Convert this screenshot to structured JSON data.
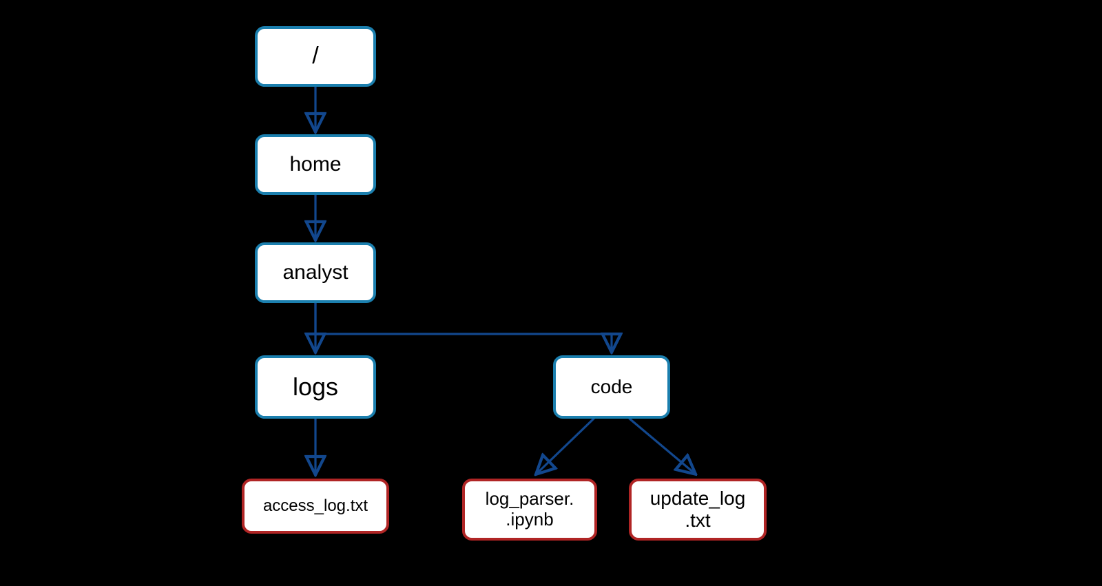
{
  "colors": {
    "background": "#000000",
    "directory_border": "#1b7fae",
    "file_border": "#b02525",
    "edge_stroke": "#12478d",
    "node_fill": "#ffffff"
  },
  "nodes": {
    "root": {
      "label": "/",
      "type": "directory"
    },
    "home": {
      "label": "home",
      "type": "directory"
    },
    "analyst": {
      "label": "analyst",
      "type": "directory"
    },
    "logs": {
      "label": "logs",
      "type": "directory"
    },
    "code": {
      "label": "code",
      "type": "directory"
    },
    "access": {
      "label": "access_log.txt",
      "type": "file"
    },
    "parser": {
      "label": "log_parser.\n.ipynb",
      "type": "file"
    },
    "update": {
      "label": "update_log\n.txt",
      "type": "file"
    }
  },
  "edges": [
    {
      "from": "root",
      "to": "home"
    },
    {
      "from": "home",
      "to": "analyst"
    },
    {
      "from": "analyst",
      "to": "logs"
    },
    {
      "from": "analyst",
      "to": "code"
    },
    {
      "from": "logs",
      "to": "access"
    },
    {
      "from": "code",
      "to": "parser"
    },
    {
      "from": "code",
      "to": "update"
    }
  ]
}
